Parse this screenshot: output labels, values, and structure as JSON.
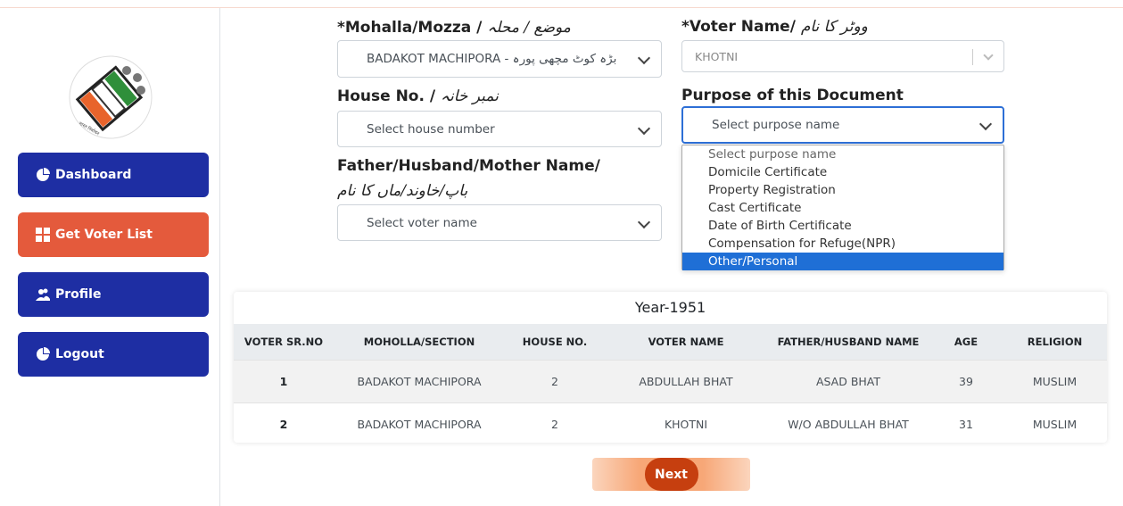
{
  "sidebar": {
    "items": [
      {
        "label": "Dashboard",
        "icon": "pie-chart-icon",
        "color": "#1e2ea3"
      },
      {
        "label": "Get Voter List",
        "icon": "grid-icon",
        "color": "#e45a3c"
      },
      {
        "label": "Profile",
        "icon": "users-icon",
        "color": "#1e2ea3"
      },
      {
        "label": "Logout",
        "icon": "pie-chart-icon",
        "color": "#1e2ea3"
      }
    ]
  },
  "form": {
    "mohalla": {
      "label": "*Mohalla/Mozza / ",
      "urdu": "موضع / محلہ",
      "value": "BADAKOT MACHIPORA - بڑہ کوٹ مچھی پورہ"
    },
    "voter": {
      "label": "*Voter Name/ ",
      "urdu": "ووٹر کا نام",
      "value": "KHOTNI"
    },
    "house": {
      "label": "House No. / ",
      "urdu": "نمبر خانہ",
      "placeholder": "Select house number"
    },
    "purpose": {
      "label": "Purpose of this Document",
      "placeholder": "Select purpose name"
    },
    "father": {
      "label": "Father/Husband/Mother Name/",
      "urdu": "باپ/خاوند/ماں کا نام",
      "placeholder": "Select voter name"
    }
  },
  "purpose_options": [
    "Select purpose name",
    "Domicile Certificate",
    "Property Registration",
    "Cast Certificate",
    "Date of Birth Certificate",
    "Compensation for Refuge(NPR)",
    "Other/Personal"
  ],
  "table": {
    "year": "Year-1951",
    "headers": [
      "VOTER SR.NO",
      "MOHOLLA/SECTION",
      "HOUSE NO.",
      "VOTER NAME",
      "FATHER/HUSBAND NAME",
      "AGE",
      "RELIGION"
    ],
    "rows": [
      [
        "1",
        "BADAKOT MACHIPORA",
        "2",
        "ABDULLAH BHAT",
        "ASAD BHAT",
        "39",
        "MUSLIM"
      ],
      [
        "2",
        "BADAKOT MACHIPORA",
        "2",
        "KHOTNI",
        "W/O ABDULLAH BHAT",
        "31",
        "MUSLIM"
      ]
    ]
  },
  "next_label": "Next"
}
